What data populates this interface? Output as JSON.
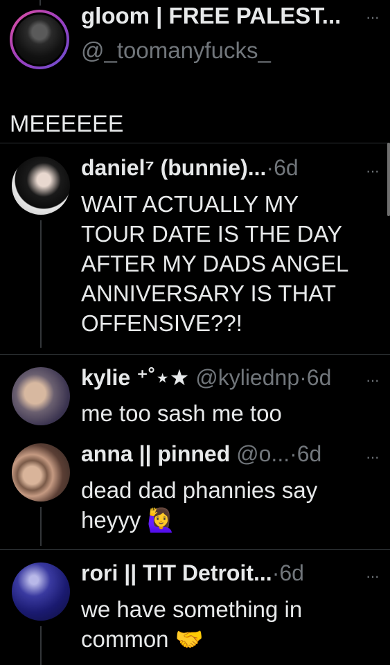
{
  "main_post": {
    "display_name": "gloom | FREE PALEST...",
    "handle": "@_toomanyfucks_",
    "text": "MEEEEEE"
  },
  "replies": [
    {
      "display_name": "daniel⁷ (bunnie)...",
      "handle": "",
      "time": "6d",
      "text_lines": [
        "WAIT ACTUALLY MY",
        "TOUR DATE IS THE DAY",
        "AFTER MY DADS ANGEL",
        "ANNIVERSARY IS THAT",
        "OFFENSIVE??!"
      ]
    },
    {
      "display_name": "kylie ⁺˚⋆★",
      "handle": "@kyliednp",
      "time": "6d",
      "text_lines": [
        "me too sash me too"
      ]
    },
    {
      "display_name": "anna || pinned",
      "handle": "@o...",
      "time": "6d",
      "text_lines": [
        "dead dad phannies say",
        "heyyy 🙋‍♀️"
      ]
    },
    {
      "display_name": "rori || TIT Detroit...",
      "handle": "",
      "time": "6d",
      "text_lines": [
        "we have something in",
        "common 🤝"
      ]
    }
  ],
  "more_icon": "···",
  "separator": "·",
  "colors": {
    "background": "#000000",
    "text": "#e7e9ea",
    "secondary": "#71767b",
    "divider": "#2f3336",
    "story_ring_start": "#e04fa0",
    "story_ring_end": "#6a4fd0"
  }
}
